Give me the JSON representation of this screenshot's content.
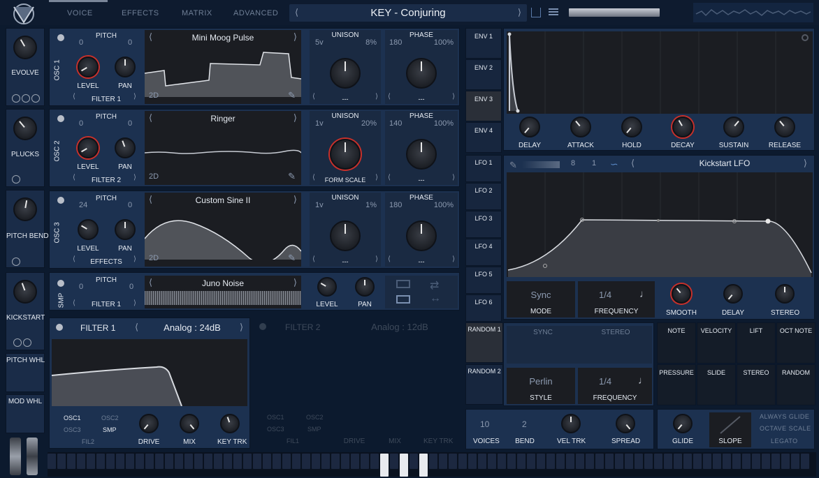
{
  "header": {
    "tabs": [
      "VOICE",
      "EFFECTS",
      "MATRIX",
      "ADVANCED"
    ],
    "preset": "KEY - Conjuring"
  },
  "macros": [
    "EVOLVE",
    "PLUCKS",
    "PITCH BEND",
    "KICKSTART",
    "PITCH WHL",
    "MOD WHL"
  ],
  "osc": [
    {
      "label": "OSC 1",
      "pitch_label": "PITCH",
      "pitch_left": "0",
      "pitch_right": "0",
      "wave": "Mini Moog Pulse",
      "level": "LEVEL",
      "pan": "PAN",
      "dest": "FILTER 1",
      "unison_label": "UNISON",
      "voices": "5v",
      "unison_pct": "8%",
      "phase_label": "PHASE",
      "phase_val": "180",
      "phase_pct": "100%",
      "sel1": "---",
      "sel2": "---",
      "dim": "2D"
    },
    {
      "label": "OSC 2",
      "pitch_label": "PITCH",
      "pitch_left": "0",
      "pitch_right": "0",
      "wave": "Ringer",
      "level": "LEVEL",
      "pan": "PAN",
      "dest": "FILTER 2",
      "unison_label": "UNISON",
      "voices": "1v",
      "unison_pct": "20%",
      "phase_label": "PHASE",
      "phase_val": "140",
      "phase_pct": "100%",
      "sel1": "FORM SCALE",
      "sel2": "---",
      "dim": "2D"
    },
    {
      "label": "OSC 3",
      "pitch_label": "PITCH",
      "pitch_left": "24",
      "pitch_right": "0",
      "wave": "Custom Sine II",
      "level": "LEVEL",
      "pan": "PAN",
      "dest": "EFFECTS",
      "unison_label": "UNISON",
      "voices": "1v",
      "unison_pct": "1%",
      "phase_label": "PHASE",
      "phase_val": "180",
      "phase_pct": "100%",
      "sel1": "---",
      "sel2": "---",
      "dim": "2D"
    }
  ],
  "smp": {
    "label": "SMP",
    "pitch_label": "PITCH",
    "pitch_left": "0",
    "pitch_right": "0",
    "sample": "Juno Noise",
    "dest": "FILTER 1",
    "level": "LEVEL",
    "pan": "PAN"
  },
  "filter1": {
    "title": "FILTER 1",
    "model": "Analog : 24dB",
    "osc1": "OSC1",
    "osc2": "OSC2",
    "osc3": "OSC3",
    "smp": "SMP",
    "fil2": "FIL2",
    "drive": "DRIVE",
    "mix": "MIX",
    "keytrk": "KEY TRK"
  },
  "filter2": {
    "title": "FILTER 2",
    "model": "Analog : 12dB",
    "osc1": "OSC1",
    "osc2": "OSC2",
    "osc3": "OSC3",
    "smp": "SMP",
    "fil1": "FIL1",
    "drive": "DRIVE",
    "mix": "MIX",
    "keytrk": "KEY TRK"
  },
  "env": {
    "tabs": [
      "ENV 1",
      "ENV 2",
      "ENV 3",
      "ENV 4"
    ],
    "knobs": [
      "DELAY",
      "ATTACK",
      "HOLD",
      "DECAY",
      "SUSTAIN",
      "RELEASE"
    ]
  },
  "lfo": {
    "tabs": [
      "LFO 1",
      "LFO 2",
      "LFO 3",
      "LFO 4",
      "LFO 5",
      "LFO 6"
    ],
    "grid_a": "8",
    "grid_b": "1",
    "preset": "Kickstart LFO",
    "sync": "Sync",
    "mode": "MODE",
    "freq_val": "1/4",
    "frequency": "FREQUENCY",
    "smooth": "SMOOTH",
    "delay": "DELAY",
    "stereo": "STEREO"
  },
  "random": {
    "tabs": [
      "RANDOM 1",
      "RANDOM 2"
    ],
    "sync": "SYNC",
    "stereo": "STEREO",
    "style_val": "Perlin",
    "style": "STYLE",
    "freq_val": "1/4",
    "frequency": "FREQUENCY"
  },
  "mod_sources": [
    "NOTE",
    "VELOCITY",
    "LIFT",
    "OCT NOTE",
    "PRESSURE",
    "SLIDE",
    "STEREO",
    "RANDOM"
  ],
  "voice": {
    "voices_val": "10",
    "voices": "VOICES",
    "bend_val": "2",
    "bend": "BEND",
    "veltrk": "VEL TRK",
    "spread": "SPREAD"
  },
  "glide": {
    "glide": "GLIDE",
    "slope": "SLOPE",
    "always": "ALWAYS GLIDE",
    "octave": "OCTAVE SCALE",
    "legato": "LEGATO"
  }
}
